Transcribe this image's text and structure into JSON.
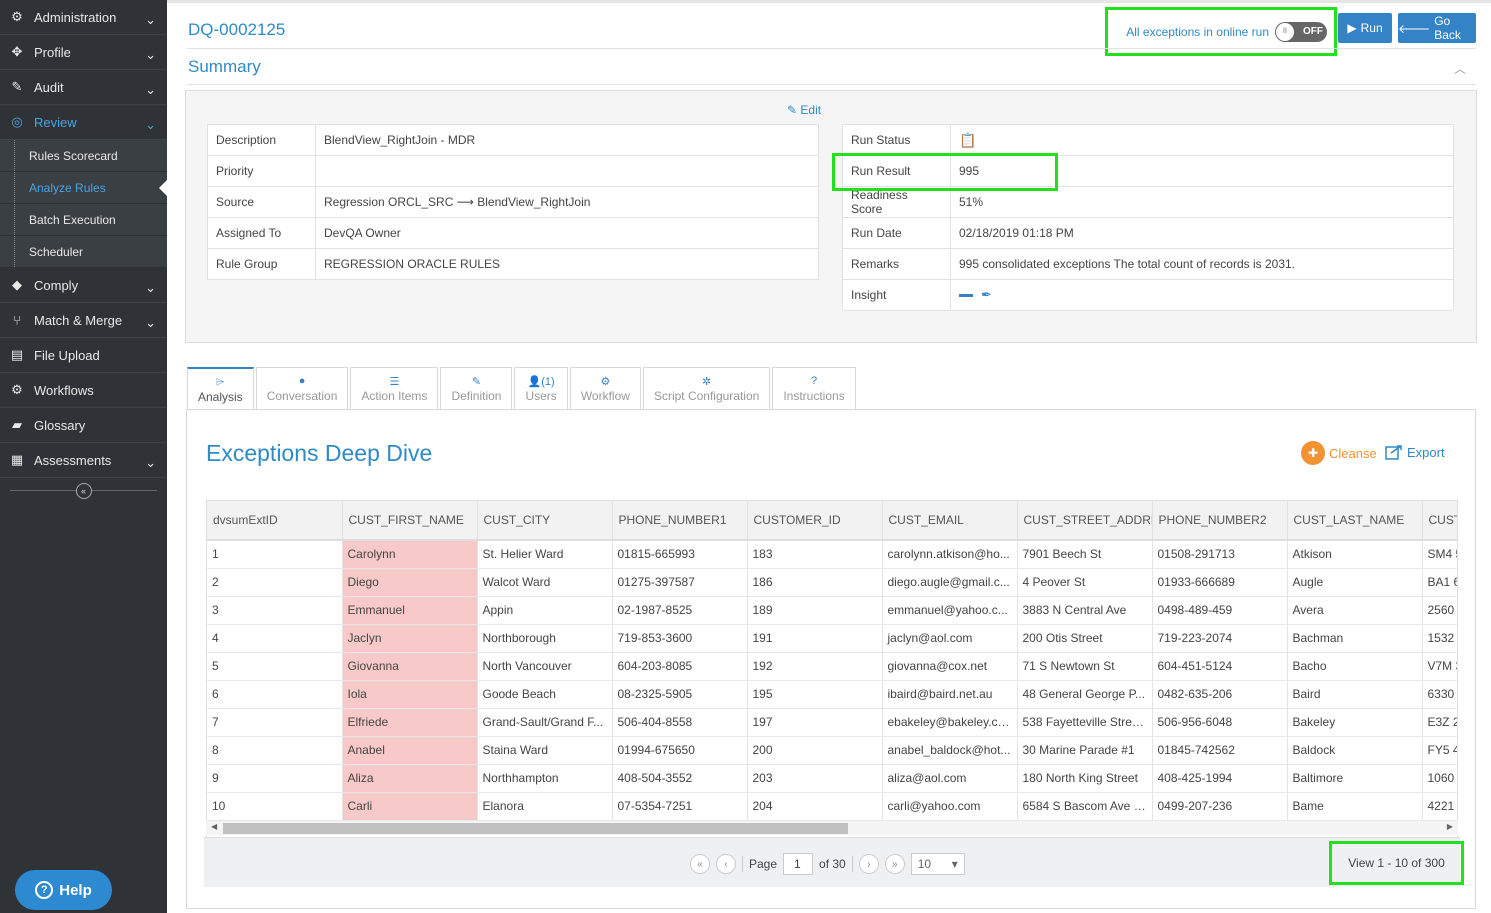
{
  "sidebar": {
    "items": [
      {
        "label": "Administration",
        "icon": "gears-icon",
        "expand": true
      },
      {
        "label": "Profile",
        "icon": "crosshair-icon",
        "expand": true
      },
      {
        "label": "Audit",
        "icon": "pencil-square-icon",
        "expand": true
      },
      {
        "label": "Review",
        "icon": "compass-icon",
        "expand": true,
        "active": true
      }
    ],
    "sub_items": [
      {
        "label": "Rules Scorecard"
      },
      {
        "label": "Analyze Rules",
        "active": true
      },
      {
        "label": "Batch Execution"
      },
      {
        "label": "Scheduler"
      }
    ],
    "items_after": [
      {
        "label": "Comply",
        "icon": "tags-icon",
        "expand": true
      },
      {
        "label": "Match & Merge",
        "icon": "code-fork-icon",
        "expand": true
      },
      {
        "label": "File Upload",
        "icon": "file-icon",
        "expand": false
      },
      {
        "label": "Workflows",
        "icon": "workflow-gears-icon",
        "expand": false
      },
      {
        "label": "Glossary",
        "icon": "book-icon",
        "expand": false
      },
      {
        "label": "Assessments",
        "icon": "clipboard-icon",
        "expand": true
      }
    ],
    "help_label": "Help"
  },
  "header": {
    "dq_id": "DQ-0002125",
    "toggle_label": "All exceptions in online run",
    "toggle_state": "OFF",
    "run_label": "Run",
    "go_back_label": "Go Back"
  },
  "summary": {
    "title": "Summary",
    "edit_label": "Edit",
    "left": [
      {
        "key": "Description",
        "value": "BlendView_RightJoin - MDR"
      },
      {
        "key": "Priority",
        "value": ""
      },
      {
        "key": "Source",
        "value": "Regression ORCL_SRC ⟶ BlendView_RightJoin"
      },
      {
        "key": "Assigned To",
        "value": "DevQA Owner"
      },
      {
        "key": "Rule Group",
        "value": "REGRESSION ORACLE RULES"
      }
    ],
    "right": [
      {
        "key": "Run Status",
        "value": ""
      },
      {
        "key": "Run Result",
        "value": "995"
      },
      {
        "key": "Readiness Score",
        "value": "51%"
      },
      {
        "key": "Run Date",
        "value": "02/18/2019 01:18 PM"
      },
      {
        "key": "Remarks",
        "value": "995 consolidated exceptions The total count of records is 2031."
      },
      {
        "key": "Insight",
        "value": ""
      }
    ]
  },
  "tabs": [
    {
      "label": "Analysis",
      "icon": "megaphone-icon",
      "glyph": "⌲",
      "active": true
    },
    {
      "label": "Conversation",
      "icon": "comment-icon",
      "glyph": "●"
    },
    {
      "label": "Action Items",
      "icon": "list-icon",
      "glyph": "☰"
    },
    {
      "label": "Definition",
      "icon": "edit-icon",
      "glyph": "✎"
    },
    {
      "label": "Users",
      "icon": "user-icon",
      "glyph": "👤(1)"
    },
    {
      "label": "Workflow",
      "icon": "cogs-icon",
      "glyph": "⚙"
    },
    {
      "label": "Script Configuration",
      "icon": "gear-icon",
      "glyph": "✲"
    },
    {
      "label": "Instructions",
      "icon": "question-icon",
      "glyph": "?"
    }
  ],
  "deep_dive": {
    "title": "Exceptions Deep Dive",
    "cleanse_label": "Cleanse",
    "export_label": "Export"
  },
  "grid": {
    "columns": [
      "dvsumExtID",
      "CUST_FIRST_NAME",
      "CUST_CITY",
      "PHONE_NUMBER1",
      "CUSTOMER_ID",
      "CUST_EMAIL",
      "CUST_STREET_ADDRESS",
      "PHONE_NUMBER2",
      "CUST_LAST_NAME",
      "CUST_"
    ],
    "rows": [
      [
        "1",
        "Carolynn",
        "St. Helier Ward",
        "01815-665993",
        "183",
        "carolynn.atkison@ho...",
        "7901 Beech St",
        "01508-291713",
        "Atkison",
        "SM4 5"
      ],
      [
        "2",
        "Diego",
        "Walcot Ward",
        "01275-397587",
        "186",
        "diego.augle@gmail.c...",
        "4 Peover St",
        "01933-666689",
        "Augle",
        "BA1 6"
      ],
      [
        "3",
        "Emmanuel",
        "Appin",
        "02-1987-8525",
        "189",
        "emmanuel@yahoo.c...",
        "3883 N Central Ave",
        "0498-489-459",
        "Avera",
        "2560"
      ],
      [
        "4",
        "Jaclyn",
        "Northborough",
        "719-853-3600",
        "191",
        "jaclyn@aol.com",
        "200 Otis Street",
        "719-223-2074",
        "Bachman",
        "1532"
      ],
      [
        "5",
        "Giovanna",
        "North Vancouver",
        "604-203-8085",
        "192",
        "giovanna@cox.net",
        "71 S Newtown St",
        "604-451-5124",
        "Bacho",
        "V7M 3"
      ],
      [
        "6",
        "Iola",
        "Goode Beach",
        "08-2325-5905",
        "195",
        "ibaird@baird.net.au",
        "48 General George P...",
        "0482-635-206",
        "Baird",
        "6330"
      ],
      [
        "7",
        "Elfriede",
        "Grand-Sault/Grand F...",
        "506-404-8558",
        "197",
        "ebakeley@bakeley.com",
        "538 Fayetteville Stree...",
        "506-956-6048",
        "Bakeley",
        "E3Z 2"
      ],
      [
        "8",
        "Anabel",
        "Staina Ward",
        "01994-675650",
        "200",
        "anabel_baldock@hot...",
        "30 Marine Parade #1",
        "01845-742562",
        "Baldock",
        "FY5 4"
      ],
      [
        "9",
        "Aliza",
        "Northhampton",
        "408-504-3552",
        "203",
        "aliza@aol.com",
        "180 North King Street",
        "408-425-1994",
        "Baltimore",
        "1060"
      ],
      [
        "10",
        "Carli",
        "Elanora",
        "07-5354-7251",
        "204",
        "carli@yahoo.com",
        "6584 S Bascom Ave #...",
        "0499-207-236",
        "Bame",
        "4221"
      ]
    ],
    "highlight_column": 1
  },
  "pager": {
    "page_label": "Page",
    "page_value": "1",
    "of_label": "of 30",
    "page_size": "10",
    "view_text": "View 1 - 10 of 300"
  },
  "colors": {
    "accent": "#2f8ac6",
    "highlight_box": "#22e01c",
    "error_cell": "#f8c9c9",
    "cleanse": "#f39232"
  }
}
